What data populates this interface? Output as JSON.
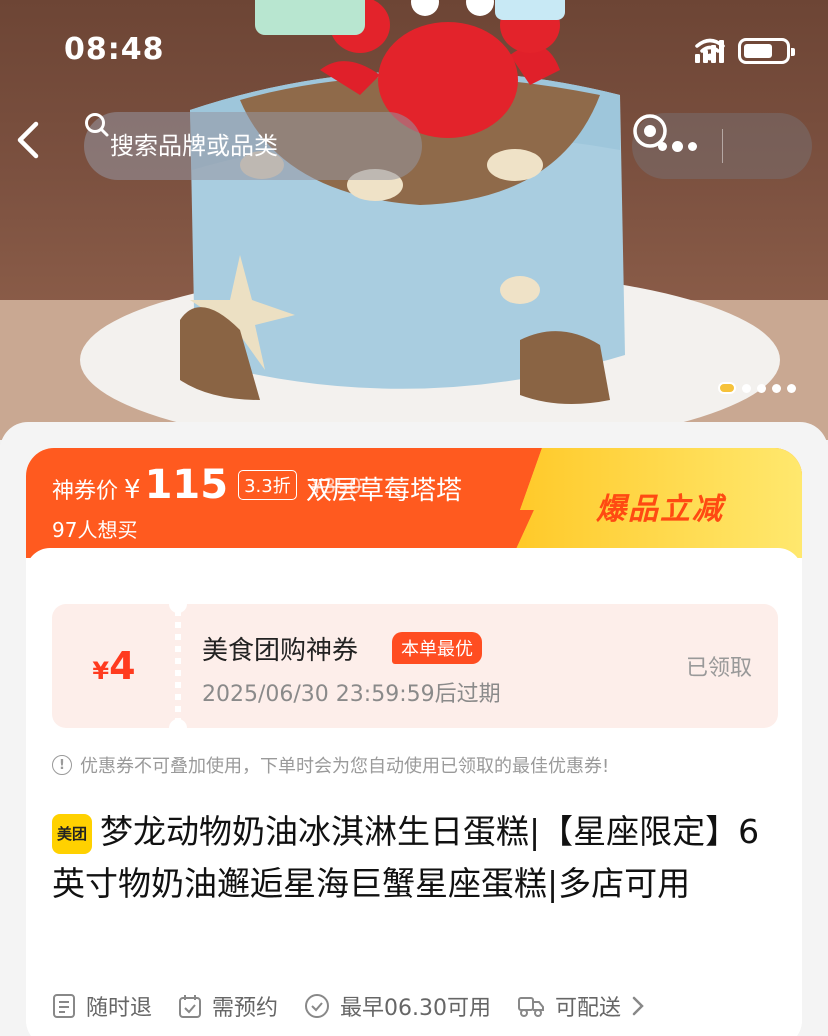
{
  "status_bar": {
    "time": "08:48"
  },
  "header": {
    "search_placeholder": "搜索品牌或品类"
  },
  "carousel": {
    "count": 5,
    "active_index": 0
  },
  "deal": {
    "price_label": "神券价",
    "currency": "¥",
    "price": "115",
    "discount": "3.3折",
    "original_price": "¥350",
    "product_short_name": "双层草莓塔塔",
    "want_count": "97人想买",
    "hot_title": "爆品立减"
  },
  "coupon": {
    "currency": "¥",
    "amount": "4",
    "name": "美食团购神券",
    "best_badge": "本单最优",
    "expiry": "2025/06/30 23:59:59后过期",
    "status": "已领取"
  },
  "notice": "优惠券不可叠加使用，下单时会为您自动使用已领取的最佳优惠券!",
  "product": {
    "brand_badge": "美团",
    "title": "梦龙动物奶油冰淇淋生日蛋糕|【星座限定】6英寸物奶油邂逅星海巨蟹星座蛋糕|多店可用"
  },
  "features": [
    {
      "icon": "receipt-icon",
      "label": "随时退"
    },
    {
      "icon": "calendar-check-icon",
      "label": "需预约"
    },
    {
      "icon": "check-circle-icon",
      "label": "最早06.30可用"
    },
    {
      "icon": "delivery-icon",
      "label": "可配送"
    }
  ],
  "colors": {
    "accent": "#ff5a1f",
    "hot_yellow": "#ffd23a",
    "coupon_bg": "#fdeeea",
    "badge_yellow": "#ffd100"
  }
}
